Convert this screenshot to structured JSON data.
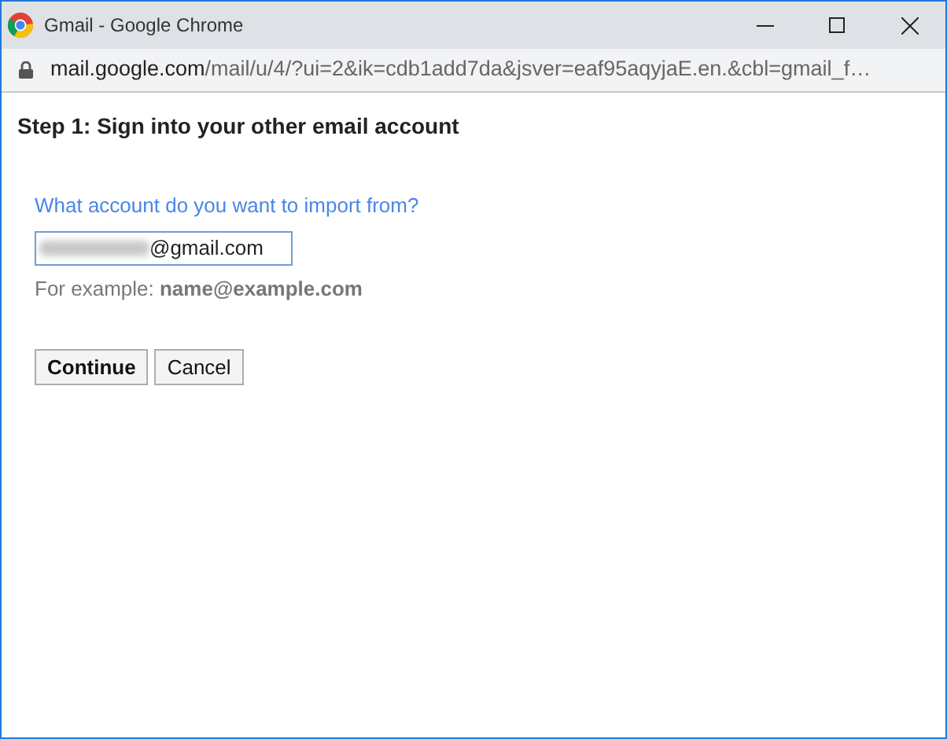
{
  "window": {
    "title": "Gmail - Google Chrome"
  },
  "address_bar": {
    "domain": "mail.google.com",
    "path": "/mail/u/4/?ui=2&ik=cdb1add7da&jsver=eaf95aqyjaE.en.&cbl=gmail_f…"
  },
  "heading": "Step 1: Sign into your other email account",
  "form": {
    "label": "What account do you want to import from?",
    "value": "@gmail.com",
    "hint": "For example: **name@example.com**"
  },
  "buttons": [
    {
      "label": "Continue",
      "kind": "primary"
    },
    {
      "label": "Cancel",
      "kind": "secondary"
    }
  ]
}
